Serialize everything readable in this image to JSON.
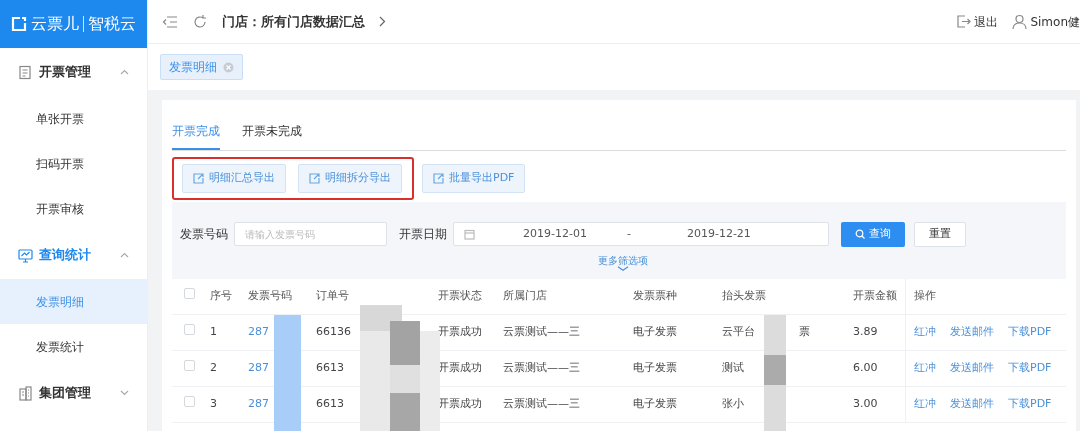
{
  "logo": {
    "brand": "云票儿",
    "product": "智税云"
  },
  "topbar": {
    "breadcrumb": "门店：所有门店数据汇总",
    "actions": [
      {
        "kind": "logout",
        "label": "退出"
      },
      {
        "kind": "user",
        "label": "Simon健"
      }
    ]
  },
  "sidebar": {
    "groups": [
      {
        "kind": "doc",
        "label": "开票管理",
        "expanded": true,
        "active": false,
        "children": [
          {
            "label": "单张开票",
            "selected": false
          },
          {
            "label": "扫码开票",
            "selected": false
          },
          {
            "label": "开票审核",
            "selected": false
          }
        ]
      },
      {
        "kind": "monitor",
        "label": "查询统计",
        "expanded": true,
        "active": true,
        "children": [
          {
            "label": "发票明细",
            "selected": true
          },
          {
            "label": "发票统计",
            "selected": false
          }
        ]
      },
      {
        "kind": "building",
        "label": "集团管理",
        "expanded": false,
        "active": false
      }
    ]
  },
  "open_tabs": [
    {
      "label": "发票明细",
      "selected": true
    }
  ],
  "tabs": [
    {
      "label": "开票完成",
      "selected": true
    },
    {
      "label": "开票未完成",
      "selected": false
    }
  ],
  "export_groups": [
    {
      "highlighted": true,
      "buttons": [
        "明细汇总导出",
        "明细拆分导出"
      ]
    },
    {
      "highlighted": false,
      "buttons": [
        "批量导出PDF"
      ]
    }
  ],
  "filters": {
    "invoice_label": "发票号码",
    "invoice_placeholder": "请输入发票号码",
    "date_label": "开票日期",
    "date_start": "2019-12-01",
    "date_separator": "-",
    "date_end": "2019-12-21",
    "search_button": "查询",
    "reset_button": "重置",
    "more": "更多筛选项"
  },
  "table": {
    "all_checked": false,
    "columns": [
      "序号",
      "发票号码",
      "订单号",
      "开票状态",
      "所属门店",
      "发票票种",
      "抬头发票",
      "开票金额",
      "操作"
    ],
    "rows": [
      {
        "checked": false,
        "cells": [
          "1",
          "287",
          "66136",
          "开票成功",
          "云票测试——三",
          "电子发票",
          "云平台",
          "3.89"
        ],
        "title_end": "票",
        "actions": [
          "红冲",
          "发送邮件",
          "下载PDF"
        ]
      },
      {
        "checked": false,
        "cells": [
          "2",
          "287",
          "6613",
          "开票成功",
          "云票测试——三",
          "电子发票",
          "测试",
          "6.00"
        ],
        "actions": [
          "红冲",
          "发送邮件",
          "下载PDF"
        ]
      },
      {
        "checked": false,
        "cells": [
          "3",
          "287",
          "6613",
          "开票成功",
          "云票测试——三",
          "电子发票",
          "张小",
          "3.00"
        ],
        "actions": [
          "红冲",
          "发送邮件",
          "下载PDF"
        ]
      }
    ]
  }
}
